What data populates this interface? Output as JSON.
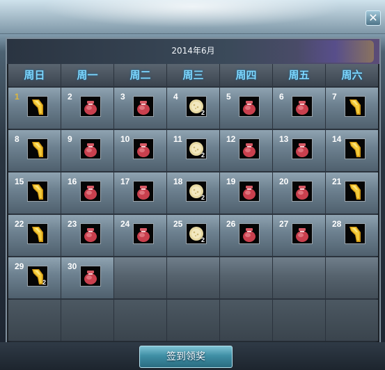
{
  "header": {
    "close_label": "✕"
  },
  "title": "2014年6月",
  "weekdays": [
    "周日",
    "周一",
    "周二",
    "周三",
    "周四",
    "周五",
    "周六"
  ],
  "today": 1,
  "days": [
    {
      "day": "1",
      "item": "gold-scroll-icon",
      "qty": ""
    },
    {
      "day": "2",
      "item": "red-pouch-icon",
      "qty": ""
    },
    {
      "day": "3",
      "item": "red-pouch-icon",
      "qty": ""
    },
    {
      "day": "4",
      "item": "mooncake-icon",
      "qty": "2"
    },
    {
      "day": "5",
      "item": "red-pouch-icon",
      "qty": ""
    },
    {
      "day": "6",
      "item": "red-pouch-icon",
      "qty": ""
    },
    {
      "day": "7",
      "item": "gold-scroll-icon",
      "qty": ""
    },
    {
      "day": "8",
      "item": "gold-scroll-icon",
      "qty": ""
    },
    {
      "day": "9",
      "item": "red-pouch-icon",
      "qty": ""
    },
    {
      "day": "10",
      "item": "red-pouch-icon",
      "qty": ""
    },
    {
      "day": "11",
      "item": "mooncake-icon",
      "qty": "2"
    },
    {
      "day": "12",
      "item": "red-pouch-icon",
      "qty": ""
    },
    {
      "day": "13",
      "item": "red-pouch-icon",
      "qty": ""
    },
    {
      "day": "14",
      "item": "gold-scroll-icon",
      "qty": ""
    },
    {
      "day": "15",
      "item": "gold-scroll-icon",
      "qty": ""
    },
    {
      "day": "16",
      "item": "red-pouch-icon",
      "qty": ""
    },
    {
      "day": "17",
      "item": "red-pouch-icon",
      "qty": ""
    },
    {
      "day": "18",
      "item": "mooncake-icon",
      "qty": "2"
    },
    {
      "day": "19",
      "item": "red-pouch-icon",
      "qty": ""
    },
    {
      "day": "20",
      "item": "red-pouch-icon",
      "qty": ""
    },
    {
      "day": "21",
      "item": "gold-scroll-icon",
      "qty": ""
    },
    {
      "day": "22",
      "item": "gold-scroll-icon",
      "qty": ""
    },
    {
      "day": "23",
      "item": "red-pouch-icon",
      "qty": ""
    },
    {
      "day": "24",
      "item": "red-pouch-icon",
      "qty": ""
    },
    {
      "day": "25",
      "item": "mooncake-icon",
      "qty": "2"
    },
    {
      "day": "26",
      "item": "red-pouch-icon",
      "qty": ""
    },
    {
      "day": "27",
      "item": "red-pouch-icon",
      "qty": ""
    },
    {
      "day": "28",
      "item": "gold-scroll-icon",
      "qty": ""
    },
    {
      "day": "29",
      "item": "gold-scroll-icon",
      "qty": "2"
    },
    {
      "day": "30",
      "item": "red-pouch-icon",
      "qty": ""
    }
  ],
  "sign_button": "签到领奖",
  "colors": {
    "weekday_text": "#7ed8ff",
    "today_text": "#e0b83a"
  }
}
